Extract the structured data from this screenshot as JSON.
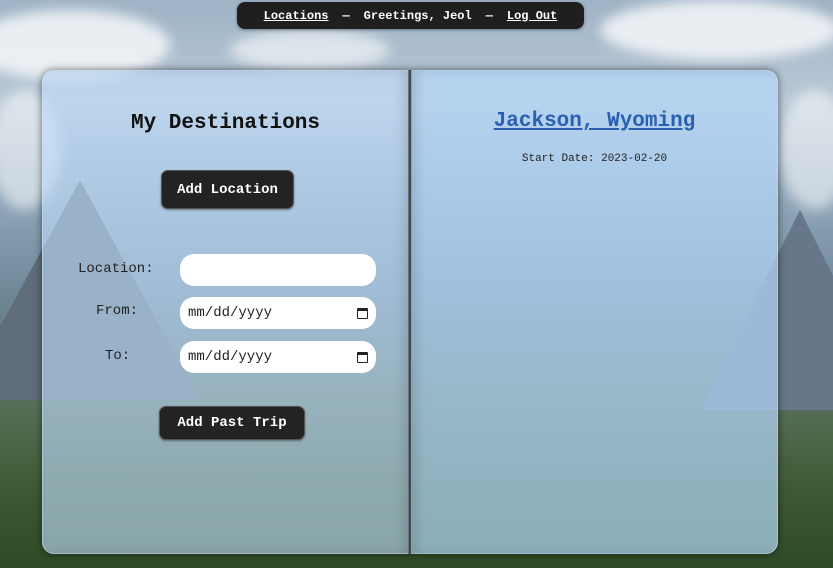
{
  "nav": {
    "locations_link": "Locations",
    "separator1": "—",
    "greeting": "Greetings, Jeol",
    "separator2": "—",
    "logout_link": "Log Out"
  },
  "left_page": {
    "title": "My Destinations",
    "add_location_button": "Add Location",
    "form": {
      "location_label": "Location:",
      "location_value": "",
      "from_label": "From:",
      "from_placeholder": "mm/dd/yyyy",
      "to_label": "To:",
      "to_placeholder": "mm/dd/yyyy"
    },
    "add_past_trip_button": "Add Past Trip"
  },
  "right_page": {
    "destination_title": "Jackson, Wyoming",
    "start_date": "Start Date: 2023-02-20"
  },
  "colors": {
    "nav_bg": "#1f1f1f",
    "button_bg": "#232323",
    "link_blue": "#2b5fb0",
    "page_tint": "#bedcfa"
  },
  "icons": {
    "date_picker": "calendar-icon"
  }
}
